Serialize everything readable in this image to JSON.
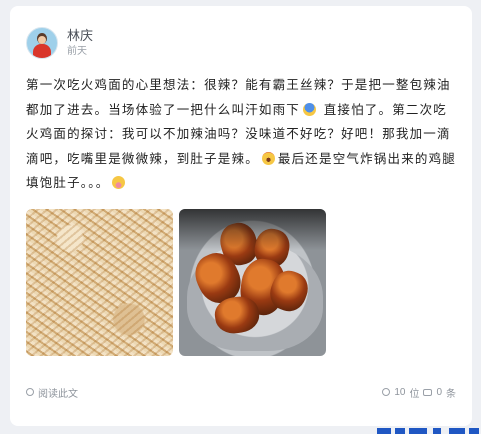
{
  "post": {
    "author": {
      "name": "林庆",
      "time": "前天",
      "avatar_icon": "avatar-icon"
    },
    "text_parts": [
      "第一次吃火鸡面的心里想法：很辣？能有霸王丝辣？于是把一整包辣油都加了进去。当场体验了一把什么叫汗如雨下",
      " 直接怕了。第二次吃火鸡面的探讨：我可以不加辣油吗？没味道不好吃？好吧！那我加一滴滴吧，吃嘴里是微微辣，到肚子是辣。",
      "最后还是空气炸锅出来的鸡腿填饱肚子。。。"
    ],
    "emoji_names": [
      "fearful-face-icon",
      "screaming-face-icon",
      "sleepy-face-icon"
    ],
    "images": [
      {
        "name": "noodles-photo"
      },
      {
        "name": "chicken-wings-photo"
      }
    ],
    "footer": {
      "read_label": "阅读此文",
      "views_count": "10",
      "views_unit": "位",
      "comments_count": "0",
      "comments_unit": "条"
    }
  },
  "colors": {
    "background": "#eef0f4",
    "card": "#ffffff",
    "text": "#222222",
    "muted": "#9aa0a8",
    "accent": "#1f57c3"
  }
}
